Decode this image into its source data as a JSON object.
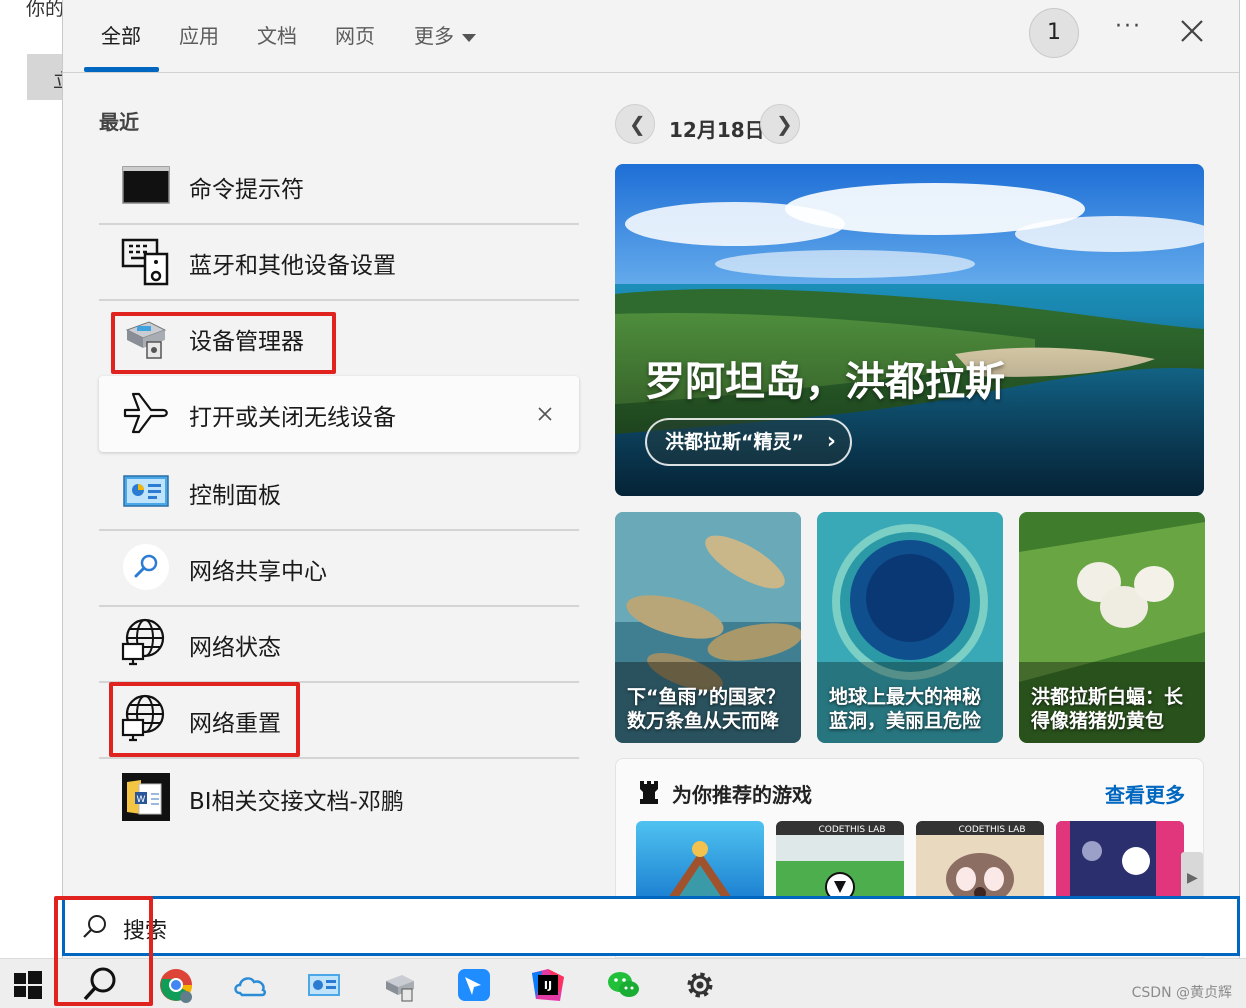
{
  "background": {
    "text": "你的",
    "button_label": "立"
  },
  "tabs": [
    {
      "label": "全部"
    },
    {
      "label": "应用"
    },
    {
      "label": "文档"
    },
    {
      "label": "网页"
    },
    {
      "label": "更多"
    }
  ],
  "header": {
    "avatar_label": "1",
    "more_label": "···"
  },
  "recent": {
    "title": "最近",
    "items": [
      {
        "label": "命令提示符",
        "icon": "terminal-icon"
      },
      {
        "label": "蓝牙和其他设备设置",
        "icon": "devices-icon"
      },
      {
        "label": "设备管理器",
        "icon": "device-manager-icon"
      },
      {
        "label": "打开或关闭无线设备",
        "icon": "airplane-icon"
      },
      {
        "label": "控制面板",
        "icon": "control-panel-icon"
      },
      {
        "label": "网络共享中心",
        "icon": "search-network-icon"
      },
      {
        "label": "网络状态",
        "icon": "network-globe-icon"
      },
      {
        "label": "网络重置",
        "icon": "network-globe-icon"
      },
      {
        "label": "BI相关交接文档-邓鹏",
        "icon": "word-document-icon"
      }
    ]
  },
  "feed": {
    "date": "12月18日",
    "hero": {
      "title": "罗阿坦岛，洪都拉斯",
      "pill": "洪都拉斯“精灵”"
    },
    "cards": [
      {
        "text": "下“鱼雨”的国家？数万条鱼从天而降"
      },
      {
        "text": "地球上最大的神秘蓝洞，美丽且危险"
      },
      {
        "text": "洪都拉斯白蝠：长得像猪猪奶黄包"
      }
    ],
    "games": {
      "title": "为你推荐的游戏",
      "more": "查看更多",
      "brand": "CODETHIS LAB"
    }
  },
  "search": {
    "placeholder": "搜索"
  },
  "taskbar": {
    "icons": [
      "windows-start-icon",
      "search-icon",
      "chrome-icon",
      "onedrive-icon",
      "control-panel-icon",
      "device-manager-icon",
      "feishu-icon",
      "intellij-icon",
      "wechat-icon",
      "settings-icon"
    ]
  },
  "watermark": "CSDN @黄贞辉",
  "colors": {
    "accent": "#0067c0",
    "highlight_box": "#e0231e",
    "panel_bg": "#f3f3f3"
  }
}
